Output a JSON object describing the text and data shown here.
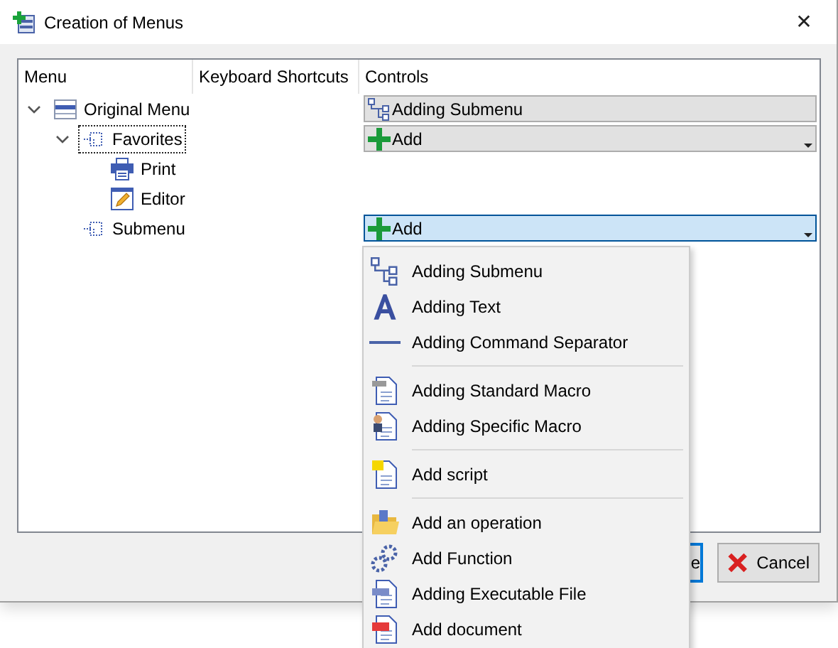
{
  "window": {
    "title": "Creation of Menus",
    "close": "✕"
  },
  "columns": [
    "Menu",
    "Keyboard Shortcuts",
    "Controls"
  ],
  "tree": [
    {
      "label": "Original Menu",
      "kind": "menu",
      "expanded": true,
      "focused": false,
      "control": {
        "label": "Adding Submenu",
        "kind": "submenu",
        "selected": false
      },
      "children": [
        {
          "label": "Favorites",
          "kind": "submenu",
          "expanded": true,
          "focused": true,
          "control": {
            "label": "Add",
            "kind": "add",
            "selected": false
          },
          "children": [
            {
              "label": "Print",
              "kind": "print",
              "focused": false
            },
            {
              "label": "Editor",
              "kind": "editor",
              "focused": false
            }
          ]
        },
        {
          "label": "Submenu",
          "kind": "submenu",
          "focused": false,
          "control": {
            "label": "Add",
            "kind": "add",
            "selected": true
          }
        }
      ]
    }
  ],
  "dropdown_menu": [
    [
      {
        "label": "Adding Submenu",
        "kind": "submenu"
      },
      {
        "label": "Adding Text",
        "kind": "text"
      },
      {
        "label": "Adding Command Separator",
        "kind": "separator"
      }
    ],
    [
      {
        "label": "Adding Standard Macro",
        "kind": "macro"
      },
      {
        "label": "Adding Specific Macro",
        "kind": "specific"
      }
    ],
    [
      {
        "label": "Add script",
        "kind": "script"
      }
    ],
    [
      {
        "label": "Add an operation",
        "kind": "operation"
      },
      {
        "label": "Add Function",
        "kind": "function"
      },
      {
        "label": "Adding Executable File",
        "kind": "exe"
      },
      {
        "label": "Add document",
        "kind": "pdf"
      }
    ]
  ],
  "buttons": [
    {
      "label": "e",
      "kind": "default"
    },
    {
      "label": "Cancel",
      "kind": "cancel"
    }
  ]
}
